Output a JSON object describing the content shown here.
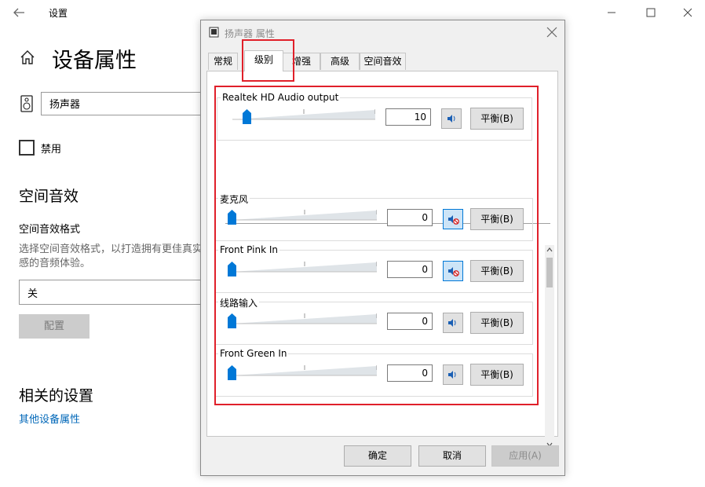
{
  "settings": {
    "title": "设置",
    "page_title": "设备属性",
    "device_name": "扬声器",
    "disable_label": "禁用",
    "spatial_heading": "空间音效",
    "spatial_format_label": "空间音效格式",
    "spatial_desc": "选择空间音效格式，以打造拥有更佳真实感的音频体验。",
    "spatial_selected": "关",
    "config_button": "配置",
    "related_heading": "相关的设置",
    "other_device_link": "其他设备属性"
  },
  "dialog": {
    "title": "扬声器 属性",
    "tabs": [
      {
        "label": "常规"
      },
      {
        "label": "级别"
      },
      {
        "label": "增强"
      },
      {
        "label": "高级"
      },
      {
        "label": "空间音效"
      }
    ],
    "active_tab": "级别",
    "output": {
      "name": "Realtek HD Audio output",
      "value": "10",
      "level": 0.1,
      "balance_label": "平衡(B)"
    },
    "inputs": [
      {
        "name": "麦克风",
        "value": "0",
        "level": 0,
        "muted": true,
        "balance_label": "平衡(B)"
      },
      {
        "name": "Front Pink In",
        "value": "0",
        "level": 0,
        "muted": true,
        "balance_label": "平衡(B)"
      },
      {
        "name": "线路输入",
        "value": "0",
        "level": 0,
        "muted": false,
        "balance_label": "平衡(B)"
      },
      {
        "name": "Front Green In",
        "value": "0",
        "level": 0,
        "muted": false,
        "balance_label": "平衡(B)"
      }
    ],
    "buttons": {
      "ok": "确定",
      "cancel": "取消",
      "apply": "应用(A)"
    }
  },
  "colors": {
    "accent": "#0078d7",
    "link": "#0067b8",
    "annotation": "#e0202a"
  }
}
